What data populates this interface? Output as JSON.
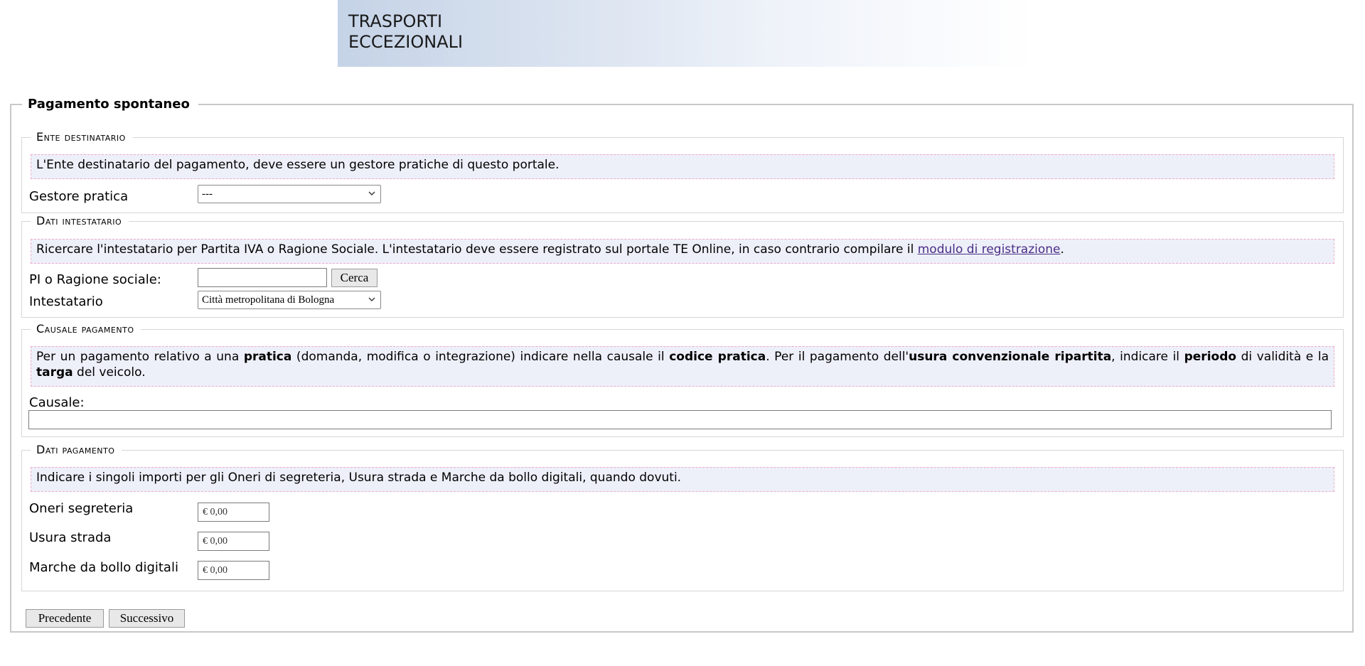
{
  "header": {
    "title_line1": "TRASPORTI",
    "title_line2": "ECCEZIONALI"
  },
  "form": {
    "title": "Pagamento spontaneo",
    "ente": {
      "legend": "Ente destinatario",
      "info": "L'Ente destinatario del pagamento, deve essere un gestore pratiche di questo portale.",
      "gestore_label": "Gestore pratica",
      "gestore_value": "---"
    },
    "intestatario": {
      "legend": "Dati intestatario",
      "info_text": "Ricercare l'intestatario per Partita IVA o Ragione Sociale. L'intestatario deve essere registrato sul portale TE Online, in caso contrario compilare il ",
      "info_link": "modulo di registrazione",
      "info_end": ".",
      "search_label": "PI o Ragione sociale:",
      "search_value": "",
      "search_button": "Cerca",
      "intestatario_label": "Intestatario",
      "intestatario_value": "Città metropolitana di Bologna"
    },
    "causale": {
      "legend": "Causale pagamento",
      "info": {
        "t1": "Per un pagamento relativo a una ",
        "b1": "pratica",
        "t2": " (domanda, modifica o integrazione) indicare nella causale il ",
        "b2": "codice pratica",
        "t3": ". Per il pagamento dell'",
        "b3": "usura convenzionale ripartita",
        "t4": ", indicare il ",
        "b4": "periodo",
        "t5": " di validità e la ",
        "b5": "targa",
        "t6": " del veicolo."
      },
      "causale_label": "Causale:",
      "causale_value": ""
    },
    "pagamento": {
      "legend": "Dati pagamento",
      "info": "Indicare i singoli importi per gli Oneri di segreteria, Usura strada e Marche da bollo digitali, quando dovuti.",
      "oneri_label": "Oneri segreteria",
      "oneri_placeholder": "€ 0,00",
      "usura_label": "Usura strada",
      "usura_placeholder": "€ 0,00",
      "marche_label": "Marche da bollo digitali",
      "marche_placeholder": "€ 0,00"
    },
    "buttons": {
      "prev": "Precedente",
      "next": "Successivo"
    }
  }
}
